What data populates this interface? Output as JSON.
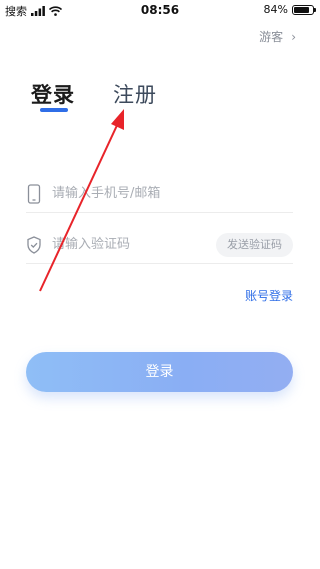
{
  "status_bar": {
    "carrier": "搜索",
    "time": "08:56",
    "battery": "84%",
    "battery_level": 0.84
  },
  "header": {
    "guest_label": "游客",
    "guest_chevron": "›"
  },
  "tabs": [
    {
      "label": "登录"
    },
    {
      "label": "注册"
    }
  ],
  "form": {
    "phone_email": {
      "placeholder": "请输入手机号/邮箱",
      "value": ""
    },
    "code": {
      "placeholder": "请输入验证码",
      "value": ""
    },
    "send_code_label": "发送验证码",
    "account_login_label": "账号登录",
    "login_button_label": "登录"
  },
  "colors": {
    "accent": "#2f6ee7",
    "annotation": "#e8242a",
    "button_gradient_start": "#8fbef6",
    "button_gradient_end": "#93aef2"
  }
}
